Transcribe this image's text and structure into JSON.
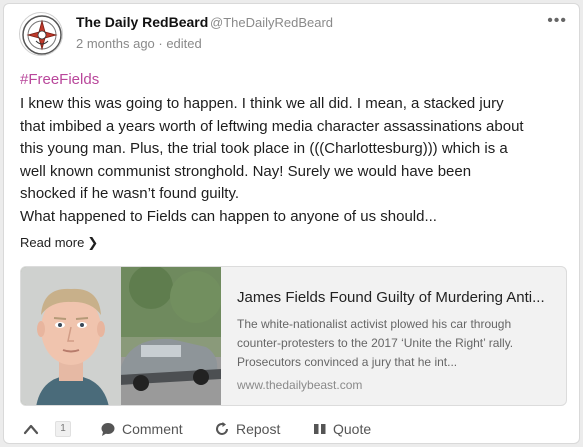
{
  "author": {
    "name": "The Daily RedBeard",
    "handle": "@TheDailyRedBeard",
    "meta": "2 months ago · edited"
  },
  "post": {
    "hashtag": "#FreeFields",
    "lines": [
      "I knew this was going to happen. I think we all did. I mean, a stacked jury",
      "that imbibed a years worth of leftwing media character assassinations about",
      "this young man. Plus, the trial took place in (((Charlottesburg))) which is a",
      "well known communist stronghold. Nay! Surely we would have been",
      "shocked if he wasn’t found guilty.",
      "What happened to Fields can happen to anyone of us should..."
    ],
    "read_more": "Read more"
  },
  "preview": {
    "title": "James Fields Found Guilty of Murdering Anti...",
    "description": "The white-nationalist activist plowed his car through counter-protesters to the 2017 ‘Unite the Right’ rally. Prosecutors convinced a jury that he int...",
    "domain": "www.thedailybeast.com"
  },
  "actions": {
    "vote_count": "1",
    "comment": "Comment",
    "repost": "Repost",
    "quote": "Quote"
  },
  "colors": {
    "hashtag": "#b9479b",
    "meta_text": "#8a8a8a"
  }
}
